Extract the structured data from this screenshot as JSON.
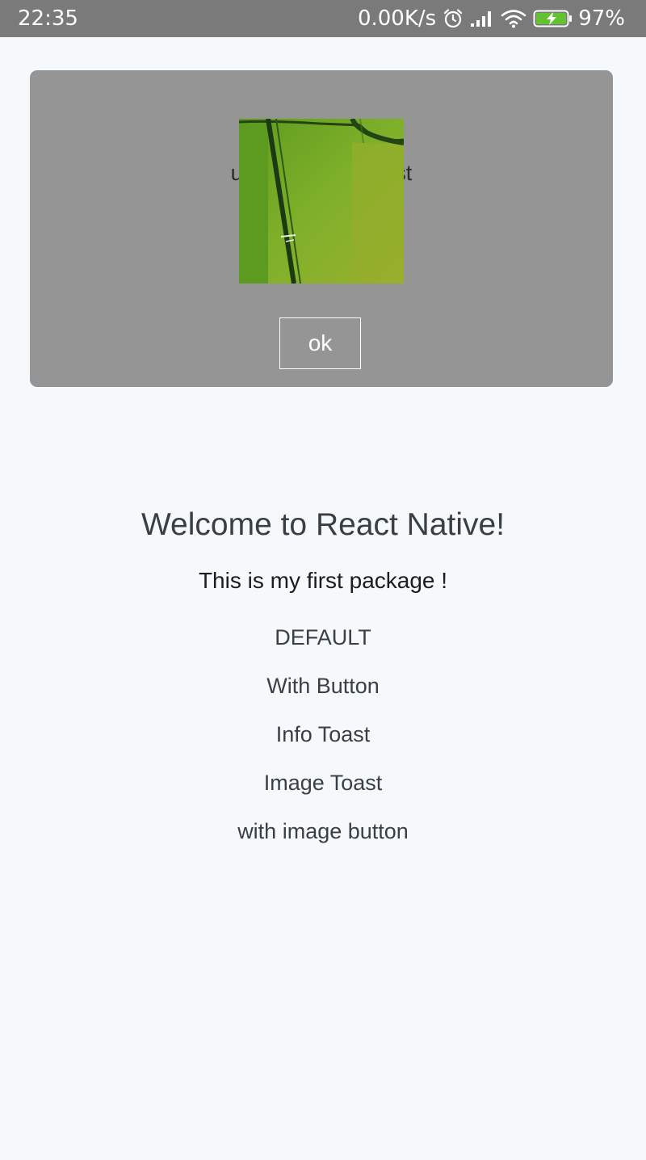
{
  "status_bar": {
    "time": "22:35",
    "net_speed": "0.00K/s",
    "battery_percent": "97%",
    "icons": [
      "alarm-icon",
      "signal-icon",
      "wifi-icon",
      "battery-charging-icon"
    ]
  },
  "toast": {
    "text": "use image in Toast",
    "image": "rice-field-aerial-image",
    "button_label": "ok"
  },
  "main": {
    "title": "Welcome to React Native!",
    "subtitle": "This is my first package !",
    "items": [
      {
        "label": "DEFAULT"
      },
      {
        "label": "With Button"
      },
      {
        "label": "Info Toast"
      },
      {
        "label": "Image Toast"
      },
      {
        "label": "with image button"
      }
    ]
  },
  "colors": {
    "status_bar_bg": "#7a7a7a",
    "page_bg": "#f6f9fc",
    "toast_bg": "#959595",
    "text_primary": "#3a3f44",
    "battery_green": "#63c232"
  }
}
